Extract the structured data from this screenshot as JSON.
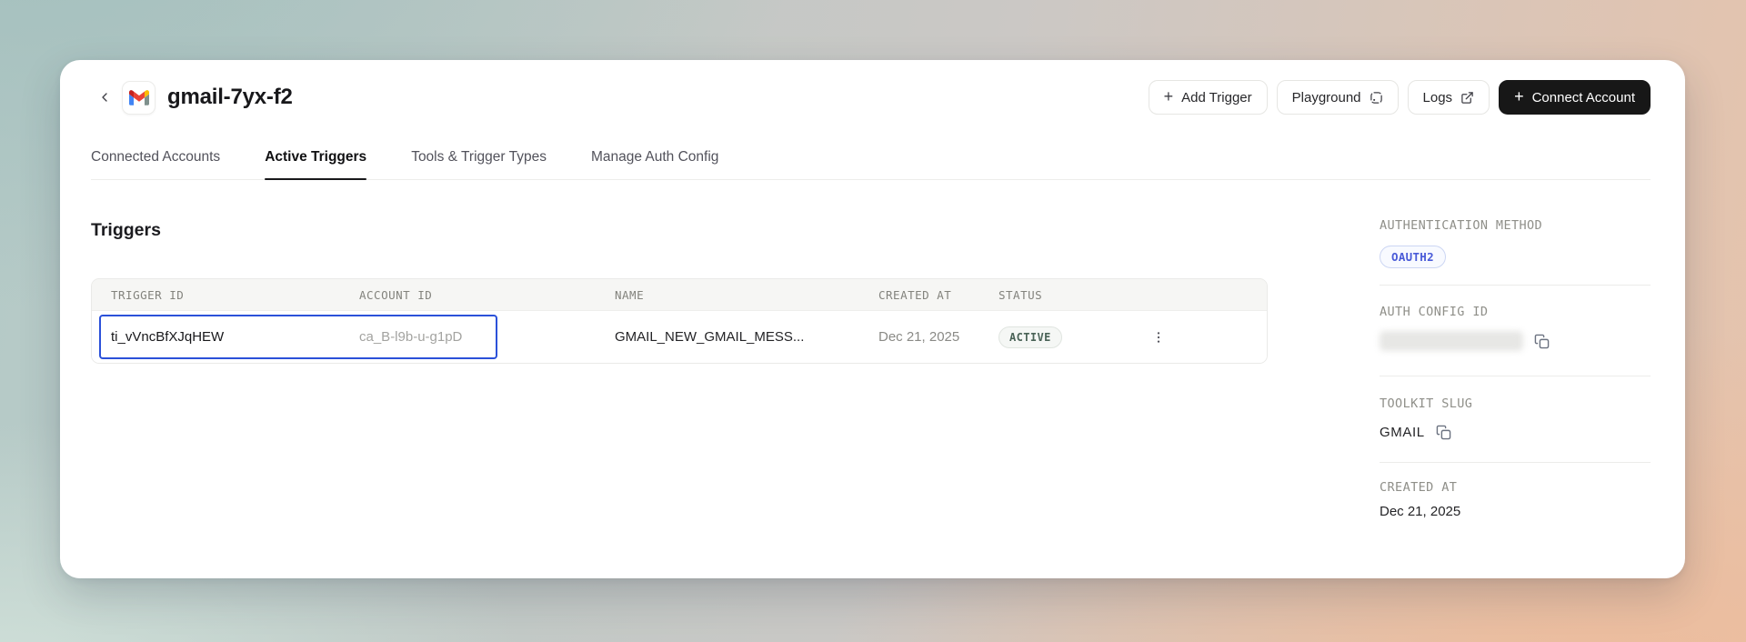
{
  "header": {
    "title": "gmail-7yx-f2",
    "app_icon": "gmail-logo",
    "buttons": [
      {
        "label": "Add Trigger",
        "icon": "plus-icon"
      },
      {
        "label": "Playground",
        "icon": "playground-icon"
      },
      {
        "label": "Logs",
        "icon": "external-link-icon"
      },
      {
        "label": "Connect Account",
        "icon": "plus-icon",
        "variant": "dark"
      }
    ]
  },
  "glyphs": {
    "plus": "+"
  },
  "tabs": [
    {
      "label": "Connected Accounts",
      "active": false
    },
    {
      "label": "Active Triggers",
      "active": true
    },
    {
      "label": "Tools & Trigger Types",
      "active": false
    },
    {
      "label": "Manage Auth Config",
      "active": false
    }
  ],
  "main": {
    "heading": "Triggers",
    "table": {
      "columns": [
        "TRIGGER ID",
        "ACCOUNT ID",
        "NAME",
        "CREATED AT",
        "STATUS"
      ],
      "rows": [
        {
          "trigger_id": "ti_vVncBfXJqHEW",
          "account_id": "ca_B-l9b-u-g1pD",
          "name": "GMAIL_NEW_GMAIL_MESS...",
          "created_at": "Dec 21, 2025",
          "status": "ACTIVE",
          "selected_cells": [
            "trigger_id",
            "account_id"
          ]
        }
      ]
    }
  },
  "sidebar": {
    "auth_method": {
      "label": "AUTHENTICATION METHOD",
      "badge": "OAUTH2"
    },
    "auth_config": {
      "label": "AUTH CONFIG ID",
      "value_redacted": true
    },
    "toolkit_slug": {
      "label": "TOOLKIT SLUG",
      "value": "GMAIL"
    },
    "created_at": {
      "label": "CREATED AT",
      "value": "Dec 21, 2025"
    }
  },
  "colors": {
    "selection_outline": "#2b51d9",
    "oauth_badge_text": "#4a5bd8",
    "active_badge_text": "#4a6357",
    "primary_button_bg": "#171717",
    "background_corners": [
      "#a5c0be",
      "#cbc8c5",
      "#cfdfd8",
      "#edbc9c"
    ]
  }
}
